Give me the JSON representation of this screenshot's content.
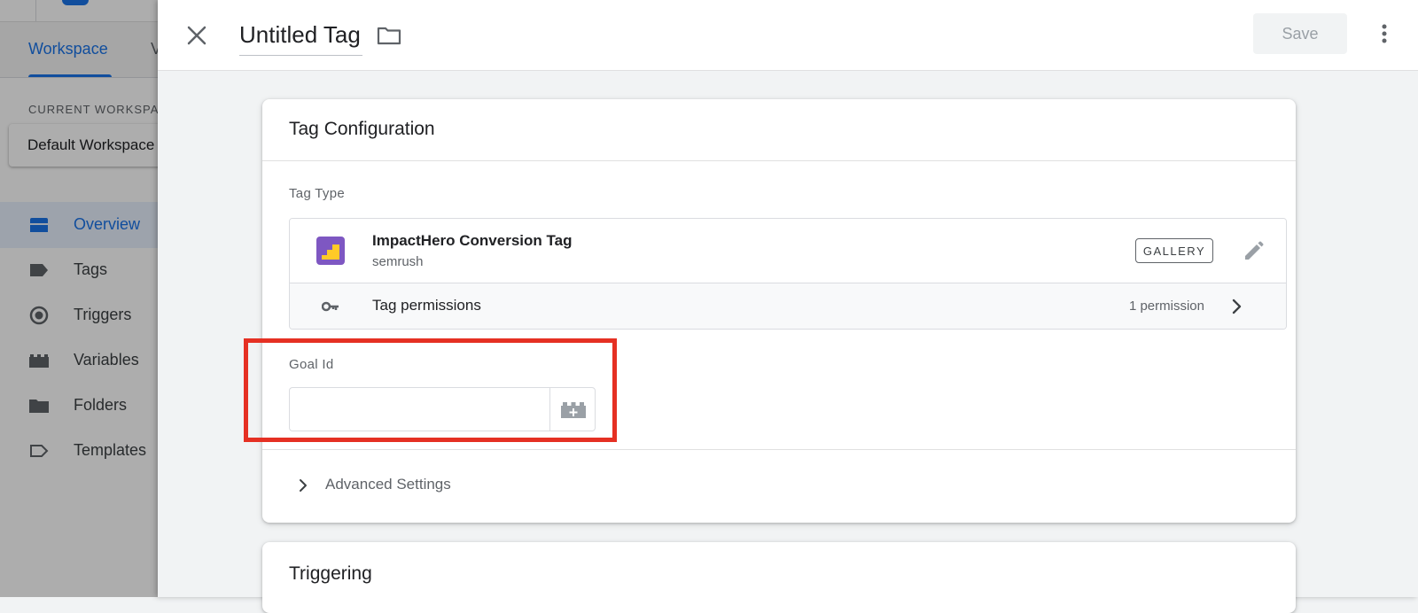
{
  "background_app": {
    "tabs": [
      "Workspace",
      "V"
    ],
    "current_workspace_label": "CURRENT WORKSPACE",
    "workspace_name": "Default Workspace",
    "nav": [
      {
        "label": "Overview",
        "icon": "overview-icon",
        "active": true
      },
      {
        "label": "Tags",
        "icon": "tag-icon",
        "active": false
      },
      {
        "label": "Triggers",
        "icon": "trigger-icon",
        "active": false
      },
      {
        "label": "Variables",
        "icon": "variables-icon",
        "active": false
      },
      {
        "label": "Folders",
        "icon": "folder-icon",
        "active": false
      },
      {
        "label": "Templates",
        "icon": "template-icon",
        "active": false
      }
    ]
  },
  "header": {
    "title": "Untitled Tag",
    "save_label": "Save"
  },
  "tag_configuration": {
    "title": "Tag Configuration",
    "tag_type_label": "Tag Type",
    "tag_type": {
      "name": "ImpactHero Conversion Tag",
      "publisher": "semrush",
      "badge": "GALLERY"
    },
    "permissions": {
      "label": "Tag permissions",
      "count": "1 permission"
    },
    "goal_id": {
      "label": "Goal Id",
      "value": "",
      "placeholder": ""
    },
    "advanced_settings_label": "Advanced Settings"
  },
  "triggering": {
    "title": "Triggering"
  },
  "colors": {
    "accent": "#1a73e8",
    "highlight": "#e53023",
    "logo_purple": "#7e57c2",
    "logo_yellow": "#ffca28"
  }
}
